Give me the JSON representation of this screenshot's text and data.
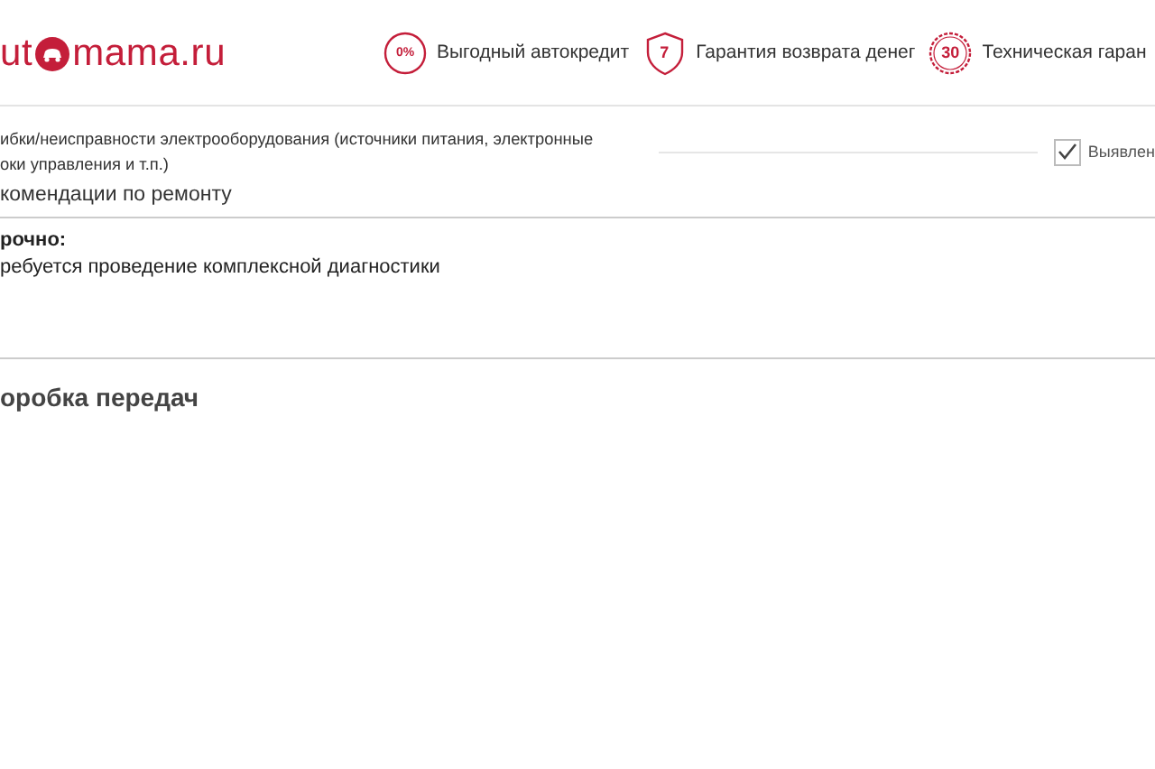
{
  "header": {
    "logo": {
      "left": "ut",
      "right": "mama.ru"
    },
    "benefits": [
      {
        "kind": "percent",
        "badge": "0%",
        "label": "Выгодный автокредит"
      },
      {
        "kind": "shield",
        "badge": "7",
        "label": "Гарантия возврата денег"
      },
      {
        "kind": "seal",
        "badge": "30",
        "label": "Техническая гаран"
      }
    ]
  },
  "fault": {
    "lines": [
      "ибки/неисправности электрооборудования (источники питания, электронные",
      "оки управления и т.п.)"
    ],
    "checkbox": {
      "label": "Выявлен",
      "checked": true
    }
  },
  "recommendations": {
    "title": "комендации по ремонту",
    "urgency": "рочно:",
    "text": "ребуется проведение комплексной диагностики"
  },
  "section": {
    "title": "оробка передач"
  }
}
